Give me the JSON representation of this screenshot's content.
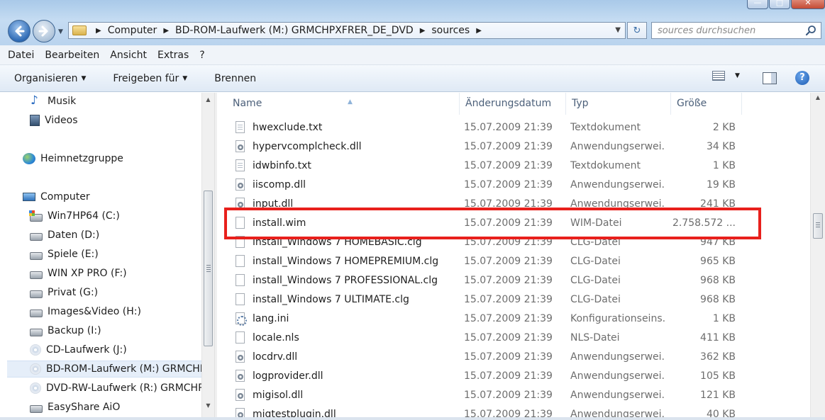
{
  "window": {
    "controls": {
      "minimize": "—",
      "maximize": "□",
      "close": "✕"
    }
  },
  "address": {
    "segments": [
      "Computer",
      "BD-ROM-Laufwerk (M:) GRMCHPXFRER_DE_DVD",
      "sources"
    ],
    "search_placeholder": "sources durchsuchen"
  },
  "menu": [
    "Datei",
    "Bearbeiten",
    "Ansicht",
    "Extras",
    "?"
  ],
  "toolbar": {
    "organize": "Organisieren",
    "share": "Freigeben für",
    "burn": "Brennen",
    "help": "?"
  },
  "nav": [
    {
      "label": "Musik",
      "icon": "music-icon"
    },
    {
      "label": "Videos",
      "icon": "video-icon"
    },
    {
      "label": "Heimnetzgruppe",
      "icon": "homegroup-icon"
    },
    {
      "label": "Computer",
      "icon": "computer-icon"
    },
    {
      "label": "Win7HP64 (C:)",
      "icon": "windows-drive-icon"
    },
    {
      "label": "Daten (D:)",
      "icon": "drive-icon"
    },
    {
      "label": "Spiele (E:)",
      "icon": "drive-icon"
    },
    {
      "label": "WIN XP PRO (F:)",
      "icon": "drive-icon"
    },
    {
      "label": "Privat (G:)",
      "icon": "drive-icon"
    },
    {
      "label": "Images&Video (H:)",
      "icon": "drive-icon"
    },
    {
      "label": "Backup (I:)",
      "icon": "drive-icon"
    },
    {
      "label": "CD-Laufwerk (J:)",
      "icon": "cd-drive-icon"
    },
    {
      "label": "BD-ROM-Laufwerk (M:) GRMCHPXFRER_DE_DVD",
      "icon": "disc-drive-icon"
    },
    {
      "label": "DVD-RW-Laufwerk (R:) GRMCHPXFRER_DE_DVD",
      "icon": "disc-drive-icon"
    },
    {
      "label": "EasyShare AiO",
      "icon": "device-icon"
    }
  ],
  "columns": {
    "name": "Name",
    "date": "Änderungsdatum",
    "type": "Typ",
    "size": "Größe"
  },
  "files": [
    {
      "name": "hwexclude.txt",
      "date": "15.07.2009 21:39",
      "type": "Textdokument",
      "size": "2 KB",
      "icon": "txt"
    },
    {
      "name": "hypervcomplcheck.dll",
      "date": "15.07.2009 21:39",
      "type": "Anwendungserwei...",
      "size": "34 KB",
      "icon": "dll"
    },
    {
      "name": "idwbinfo.txt",
      "date": "15.07.2009 21:39",
      "type": "Textdokument",
      "size": "1 KB",
      "icon": "txt"
    },
    {
      "name": "iiscomp.dll",
      "date": "15.07.2009 21:39",
      "type": "Anwendungserwei...",
      "size": "19 KB",
      "icon": "dll"
    },
    {
      "name": "input.dll",
      "date": "15.07.2009 21:39",
      "type": "Anwendungserwei...",
      "size": "241 KB",
      "icon": "dll"
    },
    {
      "name": "install.wim",
      "date": "15.07.2009 21:39",
      "type": "WIM-Datei",
      "size": "2.758.572 ...",
      "icon": "file"
    },
    {
      "name": "install_Windows 7 HOMEBASIC.clg",
      "date": "15.07.2009 21:39",
      "type": "CLG-Datei",
      "size": "947 KB",
      "icon": "file"
    },
    {
      "name": "install_Windows 7 HOMEPREMIUM.clg",
      "date": "15.07.2009 21:39",
      "type": "CLG-Datei",
      "size": "965 KB",
      "icon": "file"
    },
    {
      "name": "install_Windows 7 PROFESSIONAL.clg",
      "date": "15.07.2009 21:39",
      "type": "CLG-Datei",
      "size": "968 KB",
      "icon": "file"
    },
    {
      "name": "install_Windows 7 ULTIMATE.clg",
      "date": "15.07.2009 21:39",
      "type": "CLG-Datei",
      "size": "968 KB",
      "icon": "file"
    },
    {
      "name": "lang.ini",
      "date": "15.07.2009 21:39",
      "type": "Konfigurationseins...",
      "size": "1 KB",
      "icon": "ini"
    },
    {
      "name": "locale.nls",
      "date": "15.07.2009 21:39",
      "type": "NLS-Datei",
      "size": "411 KB",
      "icon": "file"
    },
    {
      "name": "locdrv.dll",
      "date": "15.07.2009 21:39",
      "type": "Anwendungserwei...",
      "size": "362 KB",
      "icon": "dll"
    },
    {
      "name": "logprovider.dll",
      "date": "15.07.2009 21:39",
      "type": "Anwendungserwei...",
      "size": "105 KB",
      "icon": "dll"
    },
    {
      "name": "migisol.dll",
      "date": "15.07.2009 21:39",
      "type": "Anwendungserwei...",
      "size": "121 KB",
      "icon": "dll"
    },
    {
      "name": "migtestplugin.dll",
      "date": "15.07.2009 21:39",
      "type": "Anwendungserwei...",
      "size": "40 KB",
      "icon": "dll"
    }
  ],
  "highlighted_file": "install.wim",
  "colors": {
    "highlight_border": "#e8201c",
    "window_chrome": "#b9d3ee",
    "selected_nav": "#e5eef9"
  }
}
